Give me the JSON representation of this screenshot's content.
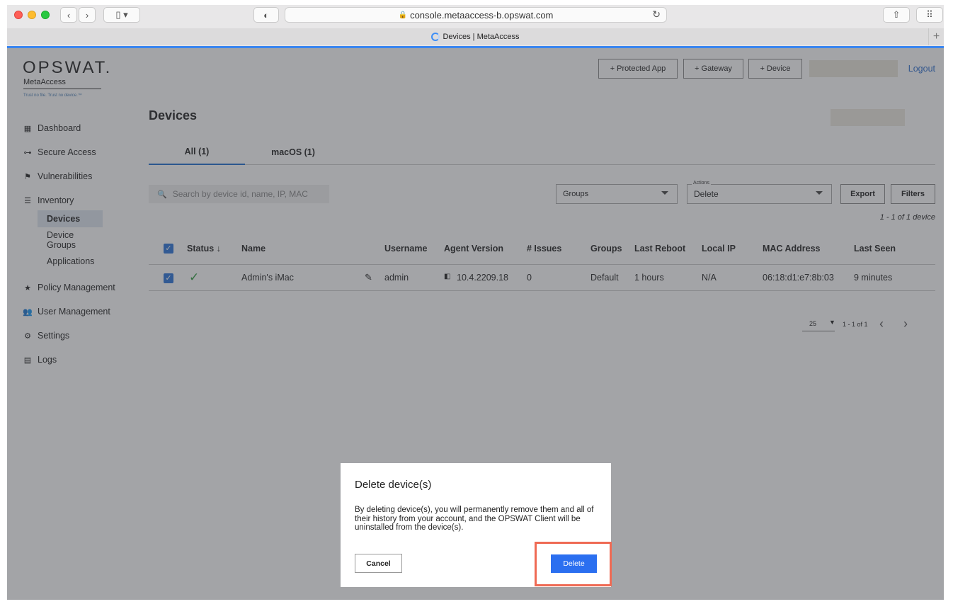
{
  "browser": {
    "url": "console.metaaccess-b.opswat.com",
    "tab_title": "Devices | MetaAccess"
  },
  "brand": {
    "logo": "OPSWAT.",
    "product": "MetaAccess",
    "tagline": "Trust no file. Trust no device.™"
  },
  "sidebar": {
    "items": [
      {
        "label": "Dashboard",
        "icon": "grid-icon"
      },
      {
        "label": "Secure Access",
        "icon": "key-icon"
      },
      {
        "label": "Vulnerabilities",
        "icon": "flag-icon"
      },
      {
        "label": "Inventory",
        "icon": "list-icon"
      },
      {
        "label": "Policy Management",
        "icon": "star-icon"
      },
      {
        "label": "User Management",
        "icon": "users-icon"
      },
      {
        "label": "Settings",
        "icon": "gear-icon"
      },
      {
        "label": "Logs",
        "icon": "clipboard-icon"
      }
    ],
    "subitems": [
      "Devices",
      "Device Groups",
      "Applications"
    ]
  },
  "topbar": {
    "protected_app": "+ Protected App",
    "gateway": "+ Gateway",
    "device": "+ Device",
    "logout": "Logout"
  },
  "page": {
    "title": "Devices",
    "tabs": [
      "All (1)",
      "macOS (1)"
    ],
    "search_placeholder": "Search by device id, name, IP, MAC",
    "groups_label": "Groups",
    "actions_label": "Actions",
    "actions_value": "Delete",
    "export": "Export",
    "filters": "Filters",
    "count_text": "1 - 1 of 1 device"
  },
  "table": {
    "headers": [
      "Status ↓",
      "Name",
      "Username",
      "Agent Version",
      "# Issues",
      "Groups",
      "Last Reboot",
      "Local IP",
      "MAC Address",
      "Last Seen"
    ],
    "row": {
      "status": "✓",
      "name": "Admin's iMac",
      "username": "admin",
      "agent_version": "10.4.2209.18",
      "issues": "0",
      "groups": "Default",
      "last_reboot": "1 hours",
      "local_ip": "N/A",
      "mac": "06:18:d1:e7:8b:03",
      "last_seen": "9 minutes"
    }
  },
  "pager": {
    "per_page": "25",
    "range": "1 - 1 of 1"
  },
  "modal": {
    "title": "Delete device(s)",
    "body": "By deleting device(s), you will permanently remove them and all of their history from your account, and the OPSWAT Client will be uninstalled from the device(s).",
    "cancel": "Cancel",
    "confirm": "Delete"
  },
  "colors": {
    "accent": "#2b6ff0",
    "highlight": "#ef6a54",
    "status_ok": "#2e9b3e"
  }
}
